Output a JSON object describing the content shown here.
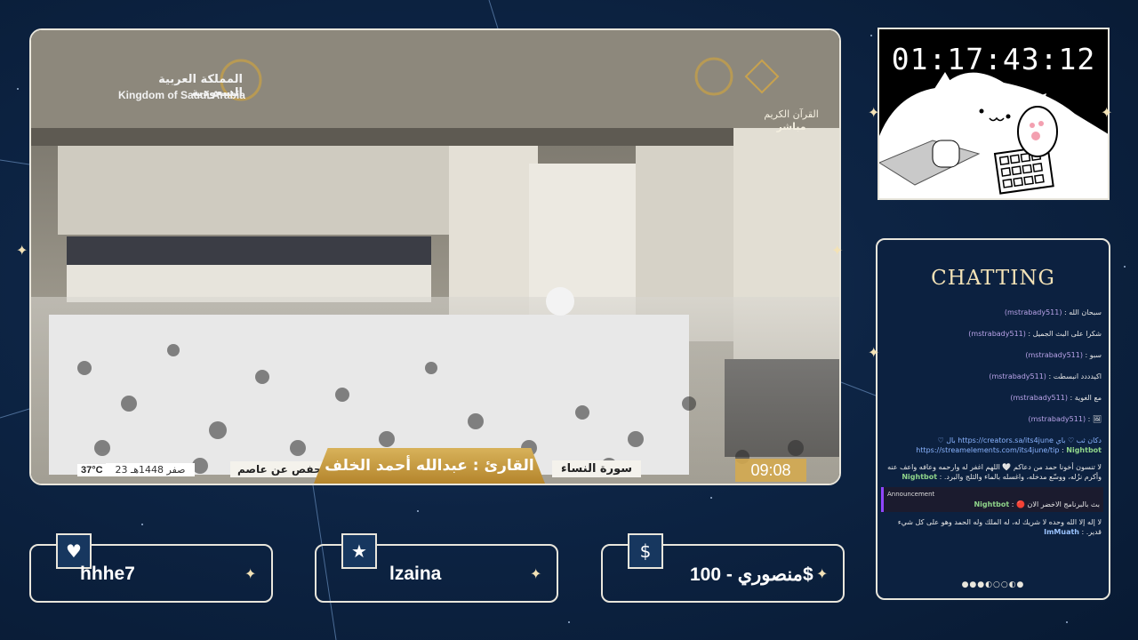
{
  "stream": {
    "broadcaster_ar": "المملكة العربية السعودية",
    "broadcaster_en": "Kingdom of Saudi Arabia",
    "channel_name": "القرآن الكريم",
    "channel_live": "مباشر",
    "temperature": "37°C",
    "date": "23 صفر 1448هـ",
    "riwaya": "رواية حفص عن عاصم",
    "qari": "القارئ : عبدالله أحمد الخلف",
    "surah": "سورة النساء",
    "clock": "09:08"
  },
  "timer": {
    "value": "01:17:43:12"
  },
  "chat": {
    "title": "CHATTING",
    "messages": [
      {
        "user": "(mstrabady511)",
        "text": "سبحان الله",
        "type": "normal"
      },
      {
        "user": "(mstrabady511)",
        "text": "شكرا على البث الجميل",
        "type": "normal"
      },
      {
        "user": "(mstrabady511)",
        "text": "سبو",
        "type": "normal"
      },
      {
        "user": "(mstrabady511)",
        "text": "اكيدددد انبسطت",
        "type": "normal"
      },
      {
        "user": "(mstrabady511)",
        "text": "مع الغوية",
        "type": "normal"
      },
      {
        "user": "(mstrabady511)",
        "text": "🖼",
        "type": "normal"
      },
      {
        "user": "Nightbot",
        "text": "دكان ثب ♡ باي https://creators.sa/its4june بال ♡ https://streamelements.com/its4june/tip",
        "type": "bot"
      },
      {
        "user": "Nightbot",
        "text": "لا تنسون أخونا حمد من دعاكم 🤍 اللهم اغفر له وارحمه وعافه واعف عنه وأكرم نزُله، ووسّع مدخله، واغسله بالماء والثلج والبرد.",
        "type": "bot"
      },
      {
        "user": "Nightbot",
        "text": "بث بالبرنامج الاخضر الان 🔴",
        "type": "announcement",
        "label": "Announcement"
      },
      {
        "user": "ImMuath",
        "text": "لا إله إلا الله وحده لا شريك له، له الملك وله الحمد وهو على كل شيء قدير.",
        "type": "user"
      }
    ],
    "pager": "●●●◐○○◐●"
  },
  "alerts": [
    {
      "icon": "heart-icon",
      "text": "hhhe7"
    },
    {
      "icon": "star-icon",
      "text": "lzaina"
    },
    {
      "icon": "dollar-icon",
      "text": "منصوري - 100$"
    }
  ],
  "colors": {
    "background": "#0d2444",
    "frame": "#e9e6dc",
    "gold": "#d8b25a",
    "chat_title": "#f3e2b6"
  }
}
